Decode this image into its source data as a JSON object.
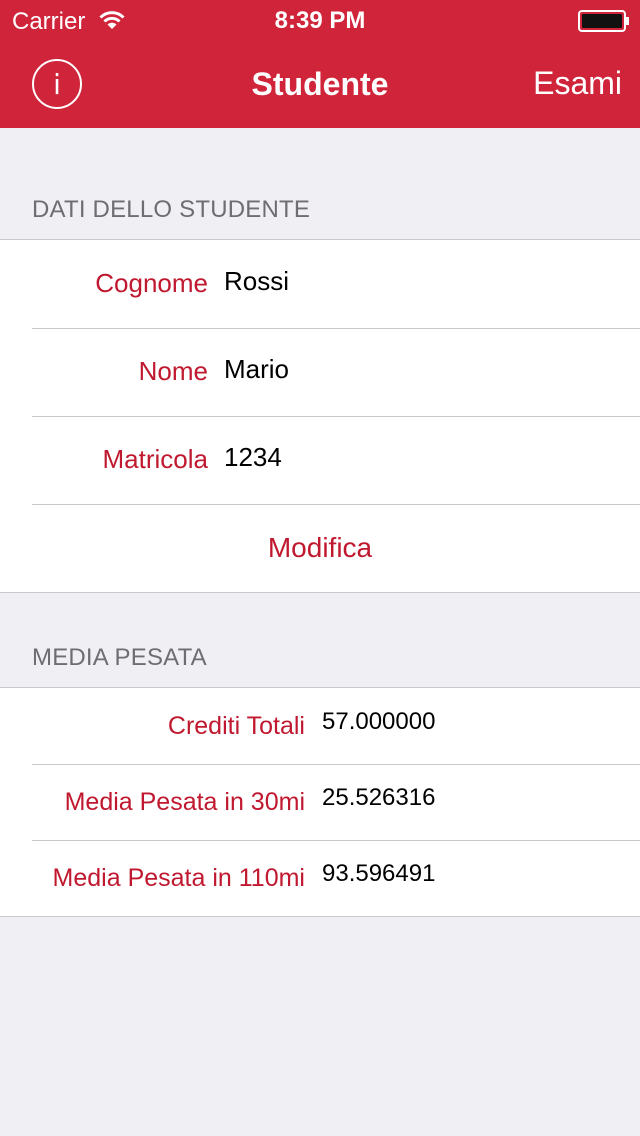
{
  "status_bar": {
    "carrier": "Carrier",
    "time": "8:39 PM"
  },
  "nav": {
    "title": "Studente",
    "right_button": "Esami"
  },
  "colors": {
    "accent": "#d0243a",
    "label": "#c0182f",
    "background": "#efeff4"
  },
  "student_section": {
    "header": "DATI DELLO STUDENTE",
    "rows": [
      {
        "label": "Cognome",
        "value": "Rossi"
      },
      {
        "label": "Nome",
        "value": "Mario"
      },
      {
        "label": "Matricola",
        "value": "1234"
      }
    ],
    "edit_button": "Modifica"
  },
  "average_section": {
    "header": "MEDIA PESATA",
    "rows": [
      {
        "label": "Crediti Totali",
        "value": "57.000000"
      },
      {
        "label": "Media Pesata in 30mi",
        "value": "25.526316"
      },
      {
        "label": "Media Pesata in 110mi",
        "value": "93.596491"
      }
    ]
  }
}
